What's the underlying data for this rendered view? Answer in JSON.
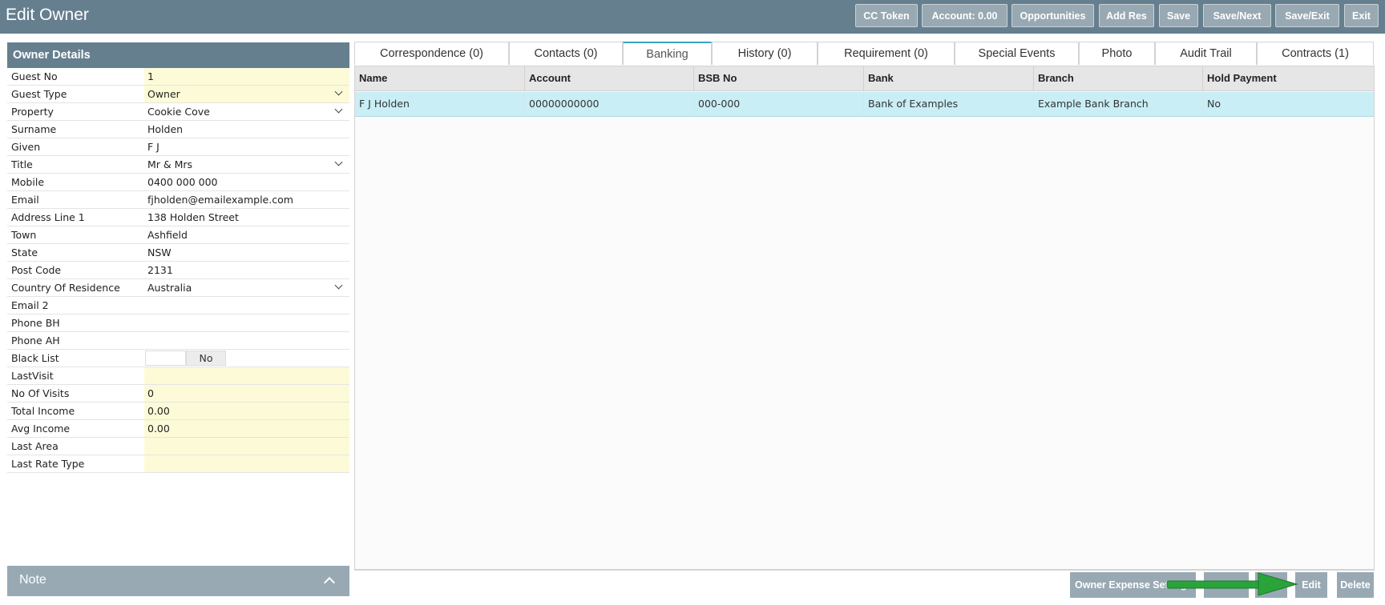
{
  "app": {
    "title": "Edit Owner"
  },
  "toolbar": {
    "cc_token": "CC Token",
    "account": "Account: 0.00",
    "opportunities": "Opportunities",
    "add_res": "Add Res",
    "save": "Save",
    "save_next": "Save/Next",
    "save_exit": "Save/Exit",
    "exit": "Exit"
  },
  "owner_details": {
    "header": "Owner Details",
    "fields": [
      {
        "label": "Guest No",
        "value": "1"
      },
      {
        "label": "Guest Type",
        "value": "Owner"
      },
      {
        "label": "Property",
        "value": "Cookie Cove"
      },
      {
        "label": "Surname",
        "value": "Holden"
      },
      {
        "label": "Given",
        "value": "F J"
      },
      {
        "label": "Title",
        "value": "Mr & Mrs"
      },
      {
        "label": "Mobile",
        "value": "0400 000 000"
      },
      {
        "label": "Email",
        "value": "fjholden@emailexample.com"
      },
      {
        "label": "Address Line 1",
        "value": "138 Holden Street"
      },
      {
        "label": "Town",
        "value": "Ashfield"
      },
      {
        "label": "State",
        "value": "NSW"
      },
      {
        "label": "Post Code",
        "value": "2131"
      },
      {
        "label": "Country Of Residence",
        "value": "Australia"
      },
      {
        "label": "Email 2",
        "value": ""
      },
      {
        "label": "Phone BH",
        "value": ""
      },
      {
        "label": "Phone AH",
        "value": ""
      },
      {
        "label": "Black List",
        "value": "No"
      },
      {
        "label": "LastVisit",
        "value": ""
      },
      {
        "label": "No Of Visits",
        "value": "0"
      },
      {
        "label": "Total Income",
        "value": "0.00"
      },
      {
        "label": "Avg Income",
        "value": "0.00"
      },
      {
        "label": "Last Area",
        "value": ""
      },
      {
        "label": "Last Rate Type",
        "value": ""
      }
    ]
  },
  "note": {
    "label": "Note"
  },
  "tabs": [
    {
      "label": "Correspondence (0)"
    },
    {
      "label": "Contacts (0)"
    },
    {
      "label": "Banking"
    },
    {
      "label": "History (0)"
    },
    {
      "label": "Requirement (0)"
    },
    {
      "label": "Special Events"
    },
    {
      "label": "Photo"
    },
    {
      "label": "Audit Trail"
    },
    {
      "label": "Contracts (1)"
    }
  ],
  "active_tab": "Banking",
  "banking_table": {
    "columns": [
      "Name",
      "Account",
      "BSB No",
      "Bank",
      "Branch",
      "Hold Payment"
    ],
    "rows": [
      [
        "F J Holden",
        "00000000000",
        "000-000",
        "Bank of Examples",
        "Example Bank Branch",
        "No"
      ]
    ]
  },
  "bottom_buttons": {
    "owner_expense": "Owner Expense Settings",
    "edit": "Edit",
    "delete": "Delete"
  },
  "colors": {
    "header": "#667f8f",
    "button": "#98a9b4",
    "active_tab_accent": "#3aa2c2",
    "selected_row": "#c9eef6",
    "readonly_field": "#fdfbd7",
    "arrow": "#2aa33b"
  }
}
